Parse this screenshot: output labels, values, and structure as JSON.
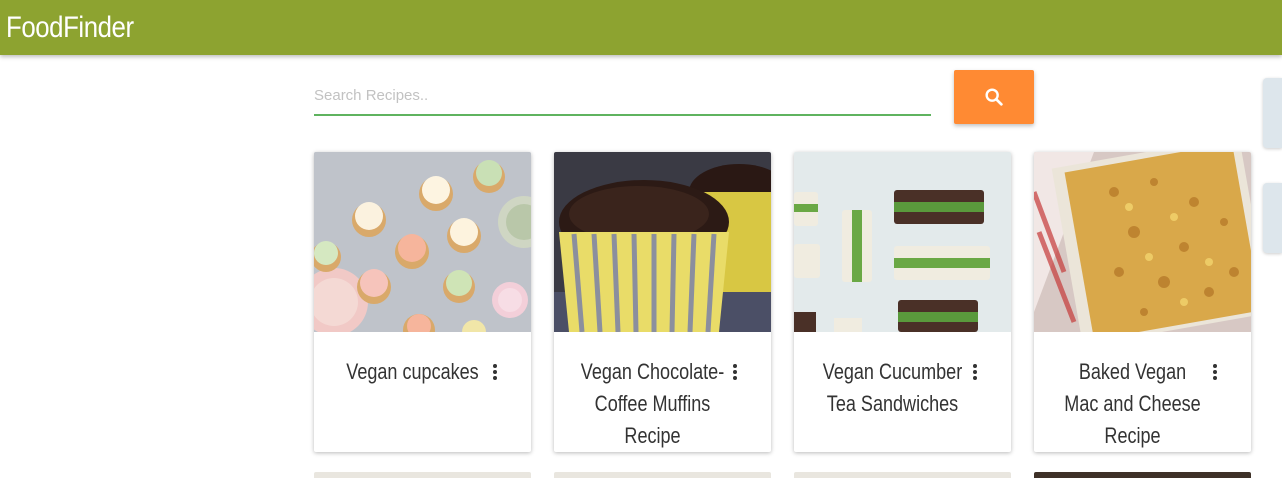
{
  "app": {
    "title": "FoodFinder"
  },
  "search": {
    "placeholder": "Search Recipes..",
    "value": "",
    "button_icon": "search-icon"
  },
  "recipes": [
    {
      "title": "Vegan cupcakes",
      "image": "pastel-cupcakes-photo"
    },
    {
      "title": "Vegan Chocolate-Coffee Muffins Recipe",
      "image": "chocolate-muffin-photo"
    },
    {
      "title": "Vegan Cucumber Tea Sandwiches",
      "image": "cucumber-sandwiches-photo"
    },
    {
      "title": "Baked Vegan Mac and Cheese Recipe",
      "image": "mac-and-cheese-photo"
    }
  ],
  "colors": {
    "appbar": "#8da330",
    "accent_button": "#ff8a33",
    "search_underline": "#5fb35f",
    "side_tab": "#dde6ec"
  }
}
